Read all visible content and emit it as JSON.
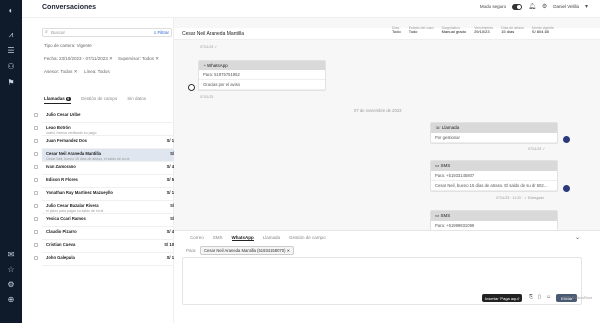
{
  "header": {
    "title": "Conversaciones",
    "mode_label": "Modo seguro",
    "user_name": "Daniel Velilla"
  },
  "left": {
    "search_placeholder": "Buscar",
    "filter_label": "Filtrar",
    "filter_estado": "Tipo de cartera: Vigente",
    "filter_fecha": "Fecha: 23/10/2023 - 07/11/2023",
    "filter_supervisor": "Supervisor: Todos",
    "filter_asesor": "Asesor: Todos",
    "filter_linea": "Línea: Todos",
    "tabs": [
      {
        "label": "Llamadas",
        "count": "9"
      },
      {
        "label": "Gestión de campo"
      },
      {
        "label": "Sin datos"
      }
    ],
    "items": [
      {
        "name": "Julio Cesar Uribe",
        "amount": "",
        "preview": "",
        "date": "07/11/23"
      },
      {
        "name": "Leao Botrón",
        "amount": "",
        "preview": "usted, hemos verificado su pago",
        "date": "07/11/23"
      },
      {
        "name": "Juan Fernandez Dos",
        "amount": "S/ 1,750.85",
        "preview": "",
        "date": "07/11/23"
      },
      {
        "name": "Cesar Neil Araneda Mantilla",
        "amount": "S/ 804.65",
        "preview": "Cesar Neil, bueno 15 días de atraso, el saldo de su dr",
        "date": "07/11/23"
      },
      {
        "name": "Ivan Zamorano",
        "amount": "S/ 4,586.34",
        "preview": "",
        "date": "07/11/23"
      },
      {
        "name": "Edison R Flores",
        "amount": "S/ 5,586.34",
        "preview": "",
        "date": "07/11/23"
      },
      {
        "name": "Yonathan Ray Martinez Mazueyllo",
        "amount": "S/ 1,525.66",
        "preview": "",
        "date": "07/11/23"
      },
      {
        "name": "Julio Cesar Bazalar Rivera",
        "amount": "S/ 804.65",
        "preview": "el plazo para pagar su saldo de mi al",
        "date": "07/11/23"
      },
      {
        "name": "Yesica Ccari Ramos",
        "amount": "S/ 867.37",
        "preview": "",
        "date": "07/11/23"
      },
      {
        "name": "Claudio Pizarro",
        "amount": "S/ 4,960.34",
        "preview": "",
        "date": "07/11/23"
      },
      {
        "name": "Cristian Cueva",
        "amount": "S/ 10,703.54",
        "preview": "",
        "date": "07/11/23"
      },
      {
        "name": "John Galepula",
        "amount": "S/ 1,198.34",
        "preview": "",
        "date": "07/11/23"
      }
    ]
  },
  "chat": {
    "contact": "Cesar Neil Araneda Mantilla",
    "meta": [
      {
        "label": "Días",
        "value": "Todo"
      },
      {
        "label": "Estado del caso",
        "value": "Todo"
      },
      {
        "label": "Diagnóstico",
        "value": "Manual grado"
      },
      {
        "label": "Vencimiento",
        "value": "29/10/23"
      },
      {
        "label": "Días de atraso",
        "value": "15 días"
      },
      {
        "label": "Monto vigente",
        "value": "S/ 804.65"
      }
    ],
    "msg1_date": "07/11/23 ✓",
    "wa_title": "WhatsApp",
    "wa_para": "Para: 51975751962",
    "wa_body": "Gracias por el aviso",
    "wa_date": "07/11/23",
    "date_sep": "07 de noviembre de 2023",
    "call_title": "Llamada",
    "call_body": "Por gestionar",
    "call_date": "07/11/23 ✓",
    "sms1_title": "SMS",
    "sms1_para": "Para: +51933145807",
    "sms1_body": "Cesar Neil, bueno 15 días de atraso. El saldo de su dr 502...",
    "sms1_date": "07/11/23 · 11:20 · ✓ Entregado",
    "sms2_title": "SMS",
    "sms2_para": "Para: +51999831099"
  },
  "compose": {
    "tabs": [
      "Correo",
      "SMS",
      "WhatsApp",
      "Llamada",
      "Gestión de campo"
    ],
    "para_label": "Para",
    "recipient": "Cesar Neil Araneda Mantilla (51934158070)",
    "insert_template": "Insertar 'Paga aquí'",
    "send_label": "Enviar"
  },
  "footer": "2023 © MicroFloor"
}
